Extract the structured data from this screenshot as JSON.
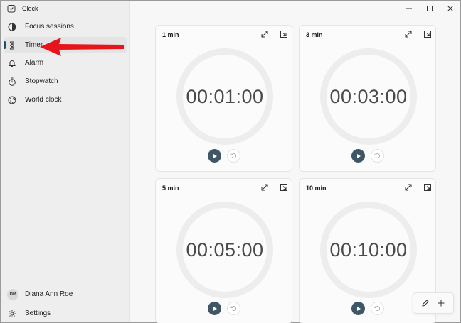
{
  "app": {
    "title": "Clock"
  },
  "sidebar": {
    "items": [
      {
        "label": "Focus sessions",
        "icon": "focus-icon"
      },
      {
        "label": "Timer",
        "icon": "hourglass-icon",
        "active": true
      },
      {
        "label": "Alarm",
        "icon": "bell-icon"
      },
      {
        "label": "Stopwatch",
        "icon": "stopwatch-icon"
      },
      {
        "label": "World clock",
        "icon": "globe-icon"
      }
    ],
    "user": {
      "initials": "DR",
      "name": "Diana Ann Roe"
    },
    "settings_label": "Settings"
  },
  "timers": [
    {
      "title": "1 min",
      "time": "00:01:00"
    },
    {
      "title": "3 min",
      "time": "00:03:00"
    },
    {
      "title": "5 min",
      "time": "00:05:00"
    },
    {
      "title": "10 min",
      "time": "00:10:00"
    }
  ],
  "colors": {
    "accent": "#1f4e6b",
    "play": "#3f5666",
    "arrow": "#e8141c"
  }
}
